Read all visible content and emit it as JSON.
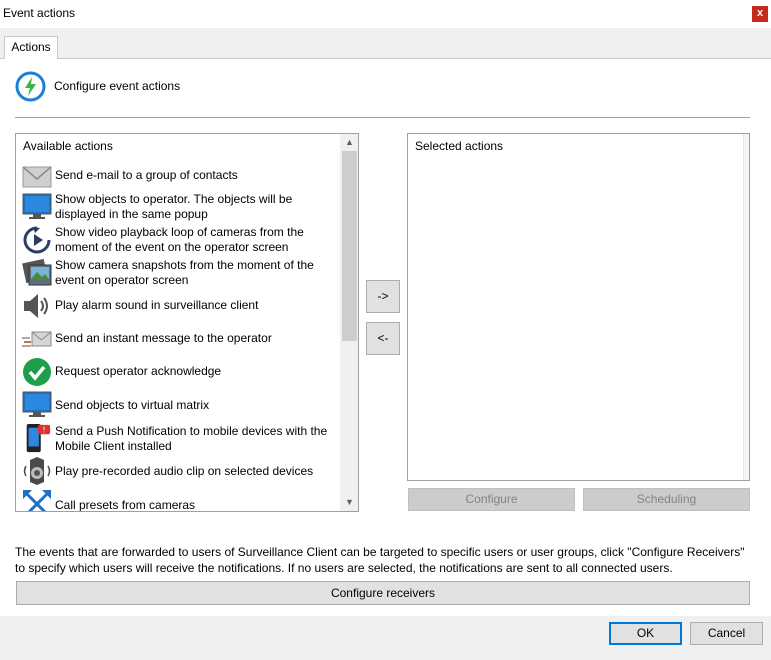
{
  "window": {
    "title": "Event actions",
    "close_label": "x"
  },
  "tab": {
    "label": "Actions"
  },
  "header": {
    "text": "Configure event actions",
    "icon": "lightning-bolt-icon",
    "accent": "#1e7fd6"
  },
  "available": {
    "heading": "Available actions",
    "items": [
      {
        "icon": "envelope-icon",
        "lines": [
          "Send e-mail to a group of contacts"
        ]
      },
      {
        "icon": "monitor-icon",
        "lines": [
          "Show objects to operator. The objects will be",
          "displayed in the same popup"
        ]
      },
      {
        "icon": "playback-loop-icon",
        "lines": [
          "Show video playback loop of cameras from the",
          "moment of the event on the operator screen"
        ]
      },
      {
        "icon": "snapshot-icon",
        "lines": [
          "Show camera snapshots from the moment of the",
          "event on operator screen"
        ]
      },
      {
        "icon": "speaker-icon",
        "lines": [
          "Play alarm sound in surveillance client"
        ]
      },
      {
        "icon": "instant-message-icon",
        "lines": [
          "Send an instant message to the operator"
        ]
      },
      {
        "icon": "check-circle-icon",
        "lines": [
          "Request operator acknowledge"
        ]
      },
      {
        "icon": "monitor-icon",
        "lines": [
          "Send objects to virtual matrix"
        ]
      },
      {
        "icon": "mobile-notification-icon",
        "lines": [
          "Send a Push Notification to mobile devices with the",
          "Mobile Client installed"
        ]
      },
      {
        "icon": "audio-device-icon",
        "lines": [
          "Play pre-recorded audio clip on selected devices"
        ]
      },
      {
        "icon": "presets-icon",
        "lines": [
          "Call presets from cameras"
        ]
      }
    ]
  },
  "transfer": {
    "add_label": "->",
    "remove_label": "<-"
  },
  "selected": {
    "heading": "Selected actions"
  },
  "buttons": {
    "configure": "Configure",
    "scheduling": "Scheduling",
    "configure_receivers": "Configure receivers",
    "ok": "OK",
    "cancel": "Cancel"
  },
  "info_text": "The events that are forwarded to users of Surveillance Client can be targeted to specific users or user groups, click \"Configure Receivers\" to specify which users will receive the notifications. If no users are selected, the notifications are sent to all connected users."
}
